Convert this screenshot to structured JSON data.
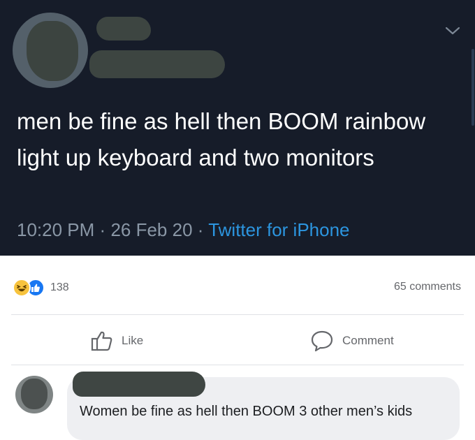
{
  "tweet": {
    "text": "men be fine as hell then BOOM rainbow light up keyboard and two monitors",
    "time": "10:20 PM",
    "date": "26 Feb 20",
    "source": "Twitter for iPhone",
    "separator": "·"
  },
  "post": {
    "reaction_count": "138",
    "comments_count": "65 comments",
    "actions": {
      "like_label": "Like",
      "comment_label": "Comment"
    }
  },
  "comment": {
    "text": "Women be fine as hell then BOOM 3 other men’s kids"
  },
  "colors": {
    "tweet_bg": "#161c29",
    "link": "#2c95df",
    "fb_gray_text": "#65676b",
    "like_blue": "#1877f2",
    "haha_yellow": "#f7c33d",
    "bubble_bg": "#eeeff2"
  }
}
